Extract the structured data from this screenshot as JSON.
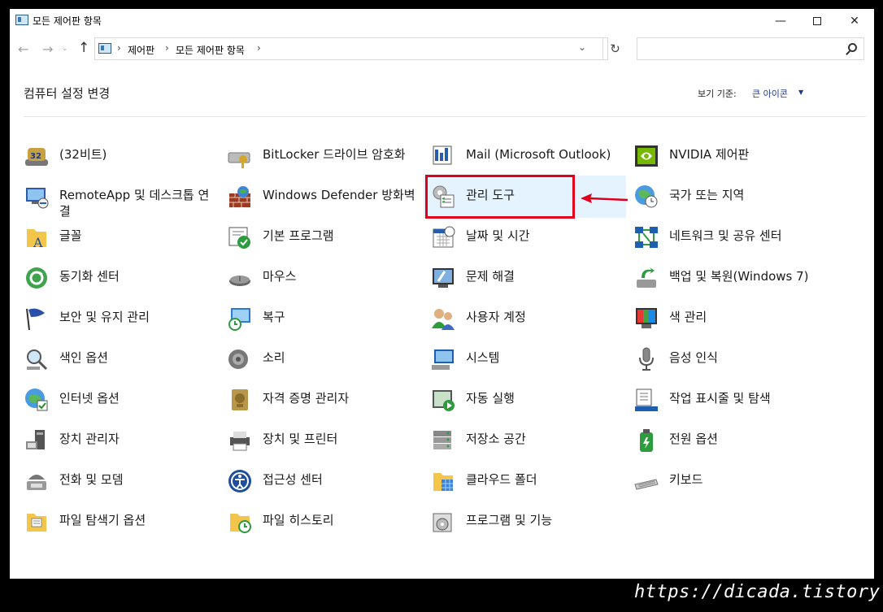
{
  "window": {
    "title": "모든 제어판 항목",
    "controls": {
      "minimize": "—",
      "maximize": "",
      "close": "✕"
    }
  },
  "nav": {
    "back": "←",
    "forward": "→",
    "history": "⌄",
    "up": "↑"
  },
  "address": {
    "crumbs": [
      "제어판",
      "모든 제어판 항목"
    ],
    "separator": "›",
    "dropdown": "⌄",
    "refresh": "↻"
  },
  "search": {
    "placeholder": ""
  },
  "header": {
    "title": "컴퓨터 설정 변경",
    "view_by_label": "보기 기준:",
    "view_by_value": "큰 아이콘",
    "caret": "▼"
  },
  "columns": [
    [
      {
        "label": "(32비트)",
        "icon": "java-32bit-icon"
      },
      {
        "label": "RemoteApp 및 데스크톱 연결",
        "icon": "remoteapp-icon"
      },
      {
        "label": "글꼴",
        "icon": "fonts-folder-icon"
      },
      {
        "label": "동기화 센터",
        "icon": "sync-center-icon"
      },
      {
        "label": "보안 및 유지 관리",
        "icon": "security-flag-icon"
      },
      {
        "label": "색인 옵션",
        "icon": "indexing-icon"
      },
      {
        "label": "인터넷 옵션",
        "icon": "internet-options-icon"
      },
      {
        "label": "장치 관리자",
        "icon": "device-manager-icon"
      },
      {
        "label": "전화 및 모뎀",
        "icon": "phone-modem-icon"
      },
      {
        "label": "파일 탐색기 옵션",
        "icon": "folder-options-icon"
      }
    ],
    [
      {
        "label": "BitLocker 드라이브 암호화",
        "icon": "bitlocker-icon"
      },
      {
        "label": "Windows Defender 방화벽",
        "icon": "firewall-icon"
      },
      {
        "label": "기본 프로그램",
        "icon": "default-programs-icon"
      },
      {
        "label": "마우스",
        "icon": "mouse-icon"
      },
      {
        "label": "복구",
        "icon": "recovery-icon"
      },
      {
        "label": "소리",
        "icon": "sound-icon"
      },
      {
        "label": "자격 증명 관리자",
        "icon": "credential-manager-icon"
      },
      {
        "label": "장치 및 프린터",
        "icon": "devices-printers-icon"
      },
      {
        "label": "접근성 센터",
        "icon": "ease-of-access-icon"
      },
      {
        "label": "파일 히스토리",
        "icon": "file-history-icon"
      }
    ],
    [
      {
        "label": "Mail (Microsoft Outlook)",
        "icon": "mail-icon"
      },
      {
        "label": "관리 도구",
        "icon": "admin-tools-icon"
      },
      {
        "label": "날짜 및 시간",
        "icon": "date-time-icon"
      },
      {
        "label": "문제 해결",
        "icon": "troubleshooting-icon"
      },
      {
        "label": "사용자 계정",
        "icon": "user-accounts-icon"
      },
      {
        "label": "시스템",
        "icon": "system-icon"
      },
      {
        "label": "자동 실행",
        "icon": "autoplay-icon"
      },
      {
        "label": "저장소 공간",
        "icon": "storage-spaces-icon"
      },
      {
        "label": "클라우드 폴더",
        "icon": "cloud-folder-icon"
      },
      {
        "label": "프로그램 및 기능",
        "icon": "programs-features-icon"
      }
    ],
    [
      {
        "label": "NVIDIA 제어판",
        "icon": "nvidia-icon"
      },
      {
        "label": "국가 또는 지역",
        "icon": "region-globe-icon"
      },
      {
        "label": "네트워크 및 공유 센터",
        "icon": "network-icon"
      },
      {
        "label": "백업 및 복원(Windows 7)",
        "icon": "backup-restore-icon"
      },
      {
        "label": "색 관리",
        "icon": "color-management-icon"
      },
      {
        "label": "음성 인식",
        "icon": "speech-recognition-icon"
      },
      {
        "label": "작업 표시줄 및 탐색",
        "icon": "taskbar-icon"
      },
      {
        "label": "전원 옵션",
        "icon": "power-options-icon"
      },
      {
        "label": "키보드",
        "icon": "keyboard-icon"
      }
    ]
  ],
  "annotation": {
    "highlight_color": "#e0001b",
    "selected_item": "관리 도구"
  },
  "watermark": "https://dicada.tistory.com"
}
